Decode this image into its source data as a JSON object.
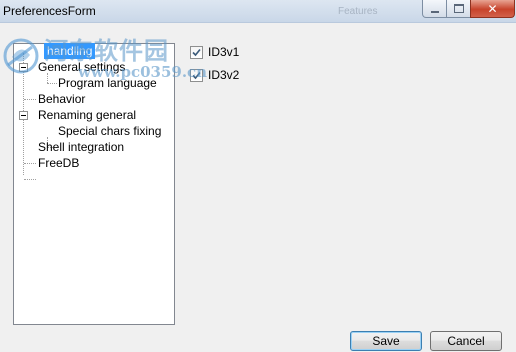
{
  "window": {
    "title": "PreferencesForm",
    "ghost_title": "Features",
    "close_glyph": "✕"
  },
  "watermark": {
    "title": "河东软件园",
    "url": "www.pc0359.cn",
    "icon": "hedong-logo"
  },
  "tree": {
    "items": [
      {
        "label": "Tag handling",
        "visible_label": "handling",
        "level": 0,
        "selected": true,
        "expander": false
      },
      {
        "label": "General settings",
        "level": 0,
        "selected": false,
        "expander": true
      },
      {
        "label": "Program language",
        "level": 1,
        "selected": false,
        "expander": false
      },
      {
        "label": "Behavior",
        "level": 0,
        "selected": false,
        "expander": false
      },
      {
        "label": "Renaming general",
        "level": 0,
        "selected": false,
        "expander": true
      },
      {
        "label": "Special chars fixing",
        "level": 1,
        "selected": false,
        "expander": false
      },
      {
        "label": "Shell integration",
        "level": 0,
        "selected": false,
        "expander": false
      },
      {
        "label": "FreeDB",
        "level": 0,
        "selected": false,
        "expander": false
      }
    ]
  },
  "options": [
    {
      "label": "ID3v1",
      "checked": true
    },
    {
      "label": "ID3v2",
      "checked": true
    }
  ],
  "buttons": {
    "save": "Save",
    "cancel": "Cancel"
  },
  "colors": {
    "selection": "#3399ff",
    "default_button_border": "#3c7fb1",
    "close_button": "#c7432b"
  }
}
